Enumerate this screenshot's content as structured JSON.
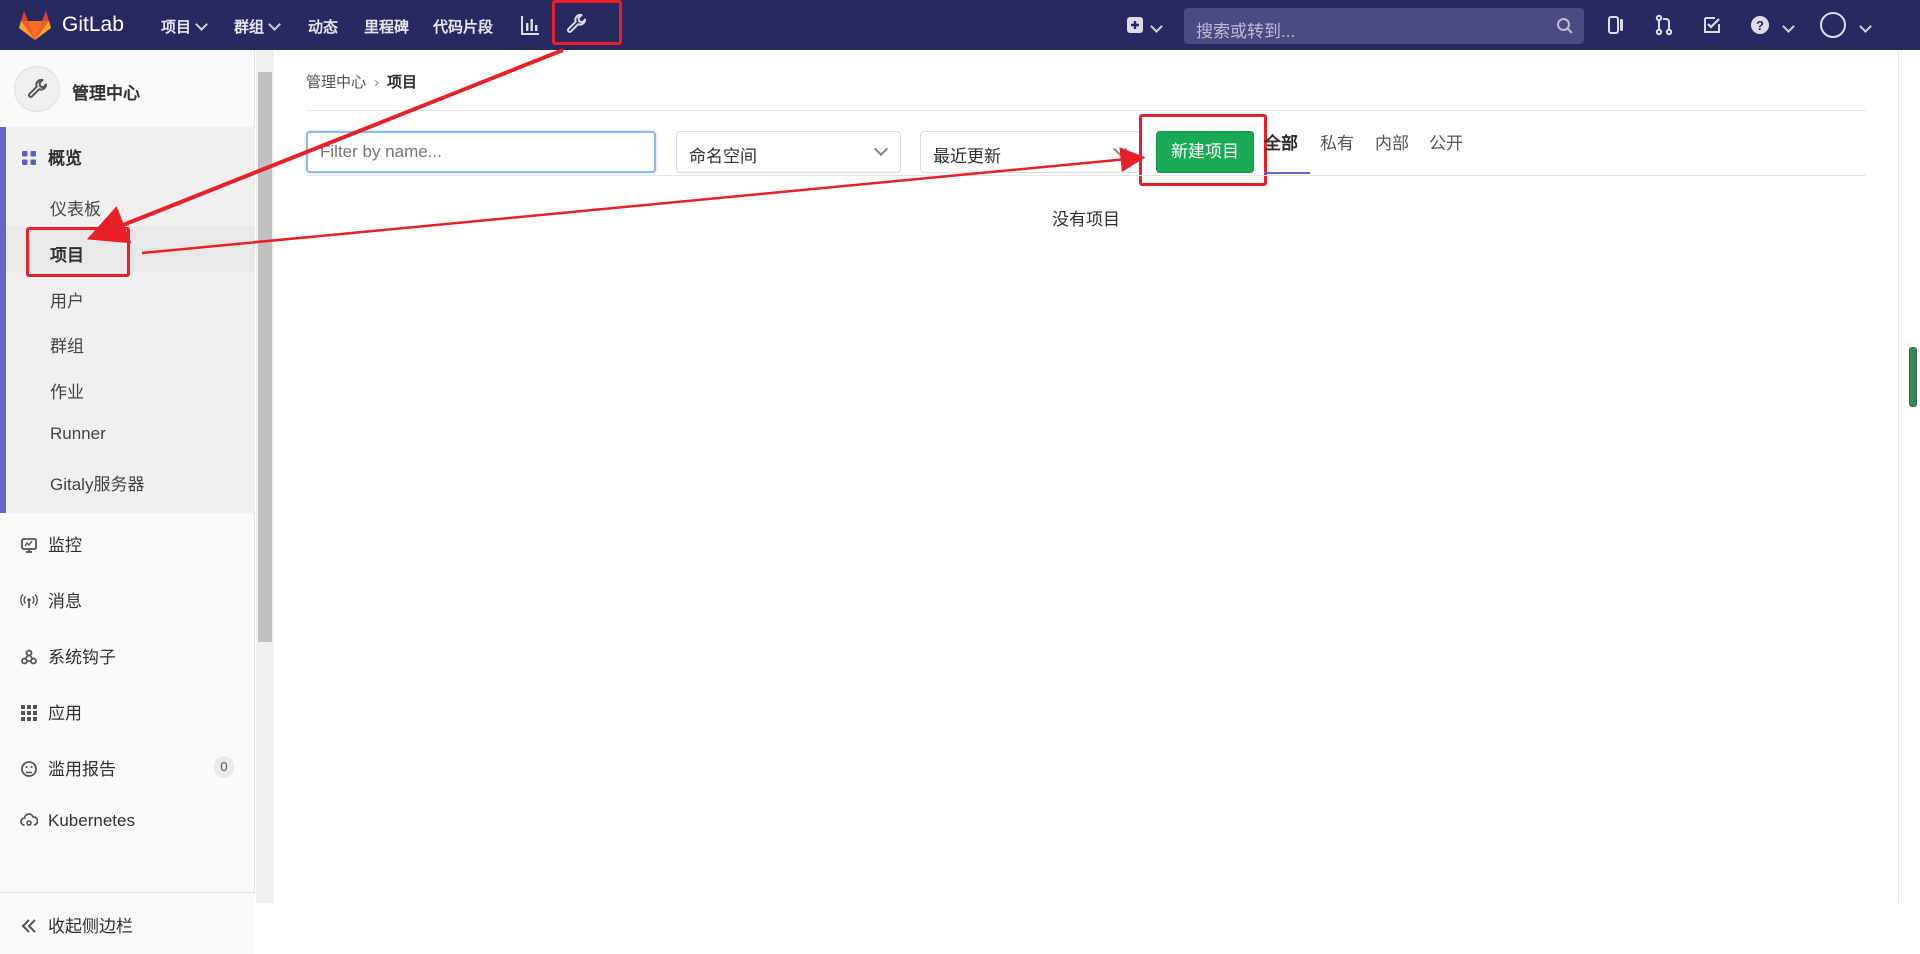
{
  "navbar": {
    "brand": "GitLab",
    "items": [
      {
        "label": "项目",
        "dropdown": true
      },
      {
        "label": "群组",
        "dropdown": true
      },
      {
        "label": "动态",
        "dropdown": false
      },
      {
        "label": "里程碑",
        "dropdown": false
      },
      {
        "label": "代码片段",
        "dropdown": false
      }
    ],
    "icons": [
      "activity-chart-icon",
      "admin-wrench-icon",
      "plus-square-icon",
      "issues-icon",
      "merge-request-icon",
      "todo-check-icon",
      "help-icon",
      "user-avatar"
    ],
    "search_placeholder": "搜索或转到..."
  },
  "sidebar": {
    "title": "管理中心",
    "section": "概览",
    "sub_items": [
      "仪表板",
      "项目",
      "用户",
      "群组",
      "作业",
      "Runner",
      "Gitaly服务器"
    ],
    "active_sub": "项目",
    "items": [
      {
        "label": "监控",
        "icon": "monitor-icon"
      },
      {
        "label": "消息",
        "icon": "broadcast-icon"
      },
      {
        "label": "系统钩子",
        "icon": "hook-icon"
      },
      {
        "label": "应用",
        "icon": "apps-grid-icon"
      },
      {
        "label": "滥用报告",
        "icon": "sad-face-icon",
        "badge": "0"
      },
      {
        "label": "Kubernetes",
        "icon": "cloud-gear-icon"
      }
    ],
    "collapse_label": "收起侧边栏"
  },
  "breadcrumb": {
    "root": "管理中心",
    "current": "项目"
  },
  "filters": {
    "name_placeholder": "Filter by name...",
    "namespace": "命名空间",
    "sort": "最近更新"
  },
  "new_project_button": "新建项目",
  "tabs": [
    "全部",
    "私有",
    "内部",
    "公开"
  ],
  "active_tab": "全部",
  "empty_message": "没有项目",
  "colors": {
    "navbar": "#292961",
    "accent": "#6666c4",
    "primary_button": "#1aaa55",
    "annotation": "#e8202a"
  }
}
